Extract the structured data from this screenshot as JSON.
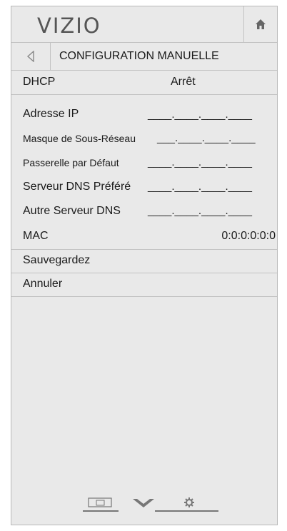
{
  "header": {
    "logo": "VIZIO",
    "home_icon": "home-icon"
  },
  "titlebar": {
    "title": "CONFIGURATION MANUELLE",
    "back_icon": "back-triangle-icon"
  },
  "dhcp": {
    "label": "DHCP",
    "value": "Arrêt"
  },
  "fields": [
    {
      "label": "Adresse IP",
      "value": "____.____.____.____"
    },
    {
      "label": "Masque de Sous-Réseau",
      "value": "___.____.____.____"
    },
    {
      "label": "Passerelle par Défaut",
      "value": "____.____.____.____"
    },
    {
      "label": "Serveur DNS Préféré",
      "value": "____.____.____.____"
    },
    {
      "label": "Autre Serveur DNS",
      "value": "____.____.____.____"
    }
  ],
  "mac": {
    "label": "MAC",
    "value": "0:0:0:0:0:0"
  },
  "actions": {
    "save": "Sauvegardez",
    "cancel": "Annuler"
  },
  "footer_icons": [
    "picture-mode-icon",
    "vizio-v-icon",
    "settings-gear-icon"
  ]
}
